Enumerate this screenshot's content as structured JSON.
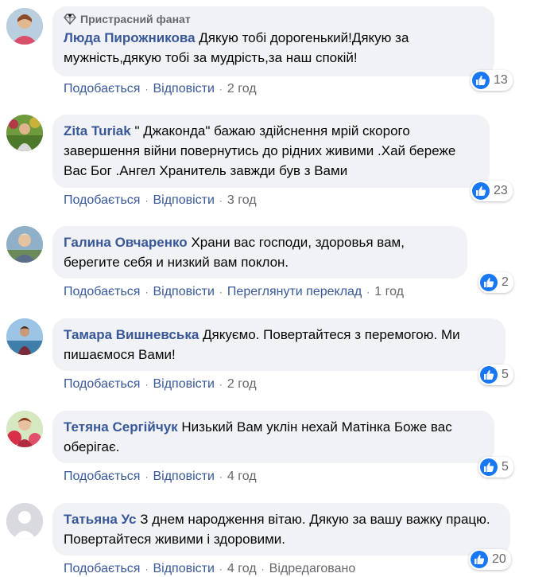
{
  "labels": {
    "like": "Подобається",
    "reply": "Відповісти",
    "see_translation": "Переглянути переклад",
    "edited": "Відредаговано",
    "top_fan": "Пристрасний фанат"
  },
  "colors": {
    "link": "#385898",
    "meta": "#65676b",
    "bubble": "#f0f2f5",
    "like_blue": "#1877f2"
  },
  "comments": [
    {
      "author": "Люда Пирожникова",
      "text": "Дякую тобі дорогенький!Дякую за мужність,дякую тобі за мудрість,за наш спокій!",
      "time": "2 год",
      "likes": "13"
    },
    {
      "author": "Zita Turiak",
      "text": "\" Джаконда\" бажаю здійснення мрій скорого завершення війни повернутись до рідних живими .Хай береже Вас Бог .Ангел Хранитель завжди був з Вами",
      "time": "3 год",
      "likes": "23"
    },
    {
      "author": "Галина Овчаренко",
      "text": "Храни вас господи, здоровья вам, берегите себя и низкий вам поклон.",
      "time": "1 год",
      "likes": "2"
    },
    {
      "author": "Тамара Вишневська",
      "text": "Дякуємо. Повертайтеся з перемогою. Ми пишаємося Вами!",
      "time": "2 год",
      "likes": "5"
    },
    {
      "author": "Тетяна Сергійчук",
      "text": "Низький Вам уклін нехай Матінка Боже вас оберігає.",
      "time": "4 год",
      "likes": "5"
    },
    {
      "author": "Татьяна Ус",
      "text": "З днем народження вітаю. Дякую за вашу важку працю. Повертайтеся живими і здоровими.",
      "time": "4 год",
      "likes": "20"
    }
  ]
}
